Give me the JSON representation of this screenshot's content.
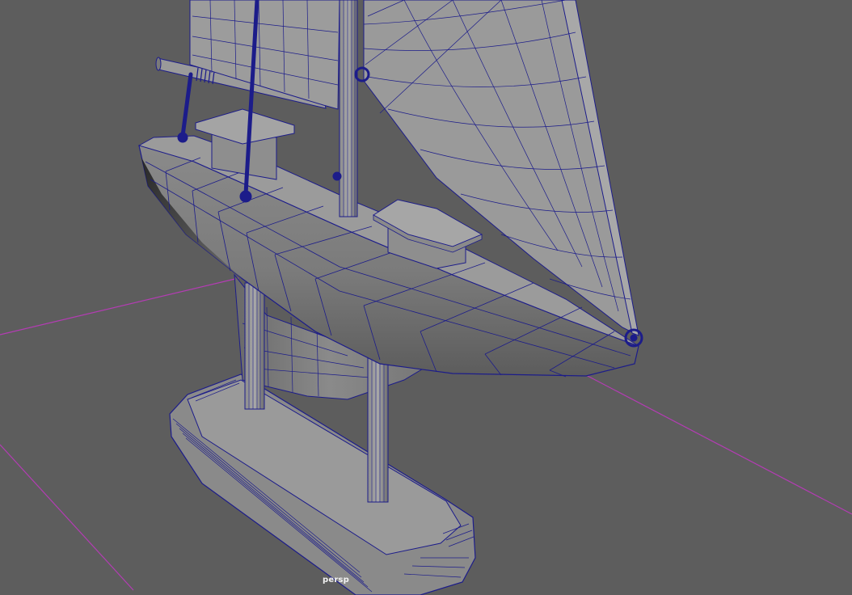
{
  "viewport": {
    "camera_label": "persp",
    "background_color": "#5d5d5d",
    "wire_color": "#1c1c8a",
    "grid_axis_color": "#b43cb4",
    "shade_light": "#8e8e8e",
    "shade_mid": "#7a7a7a",
    "shade_dark": "#5a5a5a"
  }
}
